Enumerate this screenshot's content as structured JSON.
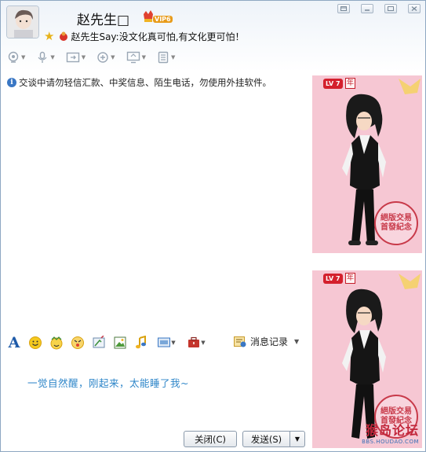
{
  "header": {
    "contact_name": "赵先生□",
    "vip_label": "VIP6",
    "signature": "赵先生Say:没文化真可怕,有文化更可怕！"
  },
  "toolbar": {
    "items": [
      "video-call",
      "voice-call",
      "file-transfer",
      "add-contact",
      "remote-desktop",
      "app-list"
    ]
  },
  "chat": {
    "notice": "交谈中请勿轻信汇款、中奖信息、陌生电话，勿使用外挂软件。"
  },
  "format_bar": {
    "font_label": "A",
    "history_label": "消息记录"
  },
  "input": {
    "text": "一觉自然醒，刚起来，太能睡了我~"
  },
  "buttons": {
    "close_label": "关闭(C)",
    "send_label": "发送(S)",
    "send_arrow": "▼"
  },
  "show_panel": {
    "level_label": "LV 7",
    "year_label": "年",
    "stamp_text": "絕版交易 首發紀念"
  },
  "watermark": {
    "logo_text": "猴岛论坛",
    "url_text": "BBS.HOUDAO.COM"
  },
  "colors": {
    "accent_blue": "#2e86c9",
    "show_bg": "#f6c7d3",
    "stamp_red": "#c83a4a"
  }
}
